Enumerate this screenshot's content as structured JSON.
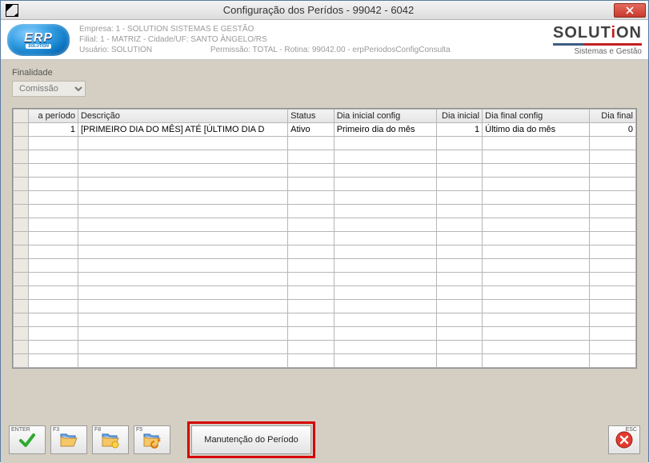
{
  "window": {
    "title": "Configuração dos Perídos - 99042 - 6042"
  },
  "header": {
    "empresa": "Empresa: 1 - SOLUTION SISTEMAS E GESTÃO",
    "filial": "Filial: 1 - MATRIZ - Cidade/UF: SANTO ÂNGELO/RS",
    "usuario": "Usuário: SOLUTION",
    "permissao": "Permissão: TOTAL - Rotina: 99042.00 - erpPeriodosConfigConsulta",
    "brand1": "SOLUT",
    "brand_i": "i",
    "brand2": "ON",
    "brand_sub": "Sistemas e Gestão",
    "erp_line1": "ERP",
    "erp_line2": "SOLUTION"
  },
  "filter": {
    "label": "Finalidade",
    "value": "Comissão"
  },
  "grid": {
    "columns": {
      "periodo": "a período",
      "descricao": "Descrição",
      "status": "Status",
      "dia_ini_cfg": "Dia inicial config",
      "dia_ini": "Dia inicial",
      "dia_fin_cfg": "Dia final config",
      "dia_fin": "Dia final"
    },
    "row": {
      "periodo": "1",
      "descricao": "[PRIMEIRO DIA DO MÊS] ATÉ [ÚLTIMO DIA D",
      "status": "Ativo",
      "dia_ini_cfg": "Primeiro dia do mês",
      "dia_ini": "1",
      "dia_fin_cfg": "Último dia do mês",
      "dia_fin": "0"
    }
  },
  "buttons": {
    "enter": "ENTER",
    "f3": "F3",
    "f8": "F8",
    "f5": "F5",
    "manutencao": "Manutenção do Período",
    "esc": "ESC"
  }
}
